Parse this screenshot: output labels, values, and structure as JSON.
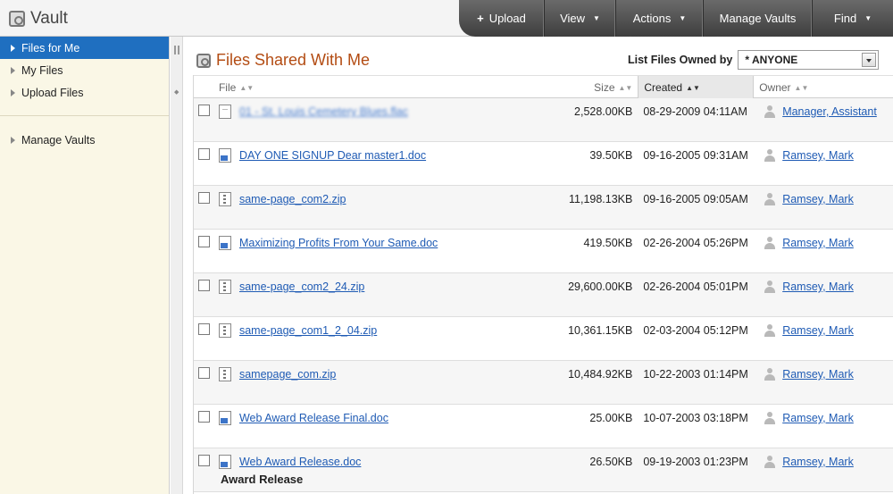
{
  "app": {
    "title": "Vault"
  },
  "topnav": [
    {
      "label": "Upload",
      "type": "plus"
    },
    {
      "label": "View",
      "type": "dropdown"
    },
    {
      "label": "Actions",
      "type": "dropdown"
    },
    {
      "label": "Manage Vaults",
      "type": "plain"
    },
    {
      "label": "Find",
      "type": "dropdown"
    }
  ],
  "sidebar": {
    "items": [
      {
        "label": "Files for Me",
        "active": true
      },
      {
        "label": "My Files",
        "active": false
      },
      {
        "label": "Upload Files",
        "active": false
      }
    ],
    "secondary": [
      {
        "label": "Manage Vaults"
      }
    ]
  },
  "page": {
    "title": "Files Shared With Me",
    "filter_label": "List Files Owned by",
    "filter_value": "* ANYONE"
  },
  "table": {
    "columns": {
      "file": "File",
      "size": "Size",
      "created": "Created",
      "owner": "Owner"
    },
    "rows": [
      {
        "file": "01 - St. Louis Cemetery Blues.flac",
        "icon": "audio",
        "blurred": true,
        "size": "2,528.00KB",
        "created": "08-29-2009 04:11AM",
        "owner": "Manager, Assistant",
        "desc": ""
      },
      {
        "file": "DAY ONE SIGNUP Dear master1.doc",
        "icon": "doc",
        "blurred": false,
        "size": "39.50KB",
        "created": "09-16-2005 09:31AM",
        "owner": "Ramsey, Mark",
        "desc": ""
      },
      {
        "file": "same-page_com2.zip",
        "icon": "zip",
        "blurred": false,
        "size": "11,198.13KB",
        "created": "09-16-2005 09:05AM",
        "owner": "Ramsey, Mark",
        "desc": ""
      },
      {
        "file": "Maximizing Profits From Your Same.doc",
        "icon": "doc",
        "blurred": false,
        "size": "419.50KB",
        "created": "02-26-2004 05:26PM",
        "owner": "Ramsey, Mark",
        "desc": ""
      },
      {
        "file": "same-page_com2_24.zip",
        "icon": "zip",
        "blurred": false,
        "size": "29,600.00KB",
        "created": "02-26-2004 05:01PM",
        "owner": "Ramsey, Mark",
        "desc": ""
      },
      {
        "file": "same-page_com1_2_04.zip",
        "icon": "zip",
        "blurred": false,
        "size": "10,361.15KB",
        "created": "02-03-2004 05:12PM",
        "owner": "Ramsey, Mark",
        "desc": ""
      },
      {
        "file": "samepage_com.zip",
        "icon": "zip",
        "blurred": false,
        "size": "10,484.92KB",
        "created": "10-22-2003 01:14PM",
        "owner": "Ramsey, Mark",
        "desc": ""
      },
      {
        "file": "Web Award Release Final.doc",
        "icon": "doc",
        "blurred": false,
        "size": "25.00KB",
        "created": "10-07-2003 03:18PM",
        "owner": "Ramsey, Mark",
        "desc": ""
      },
      {
        "file": "Web Award Release.doc",
        "icon": "doc",
        "blurred": false,
        "size": "26.50KB",
        "created": "09-19-2003 01:23PM",
        "owner": "Ramsey, Mark",
        "desc": "Award Release"
      }
    ]
  }
}
